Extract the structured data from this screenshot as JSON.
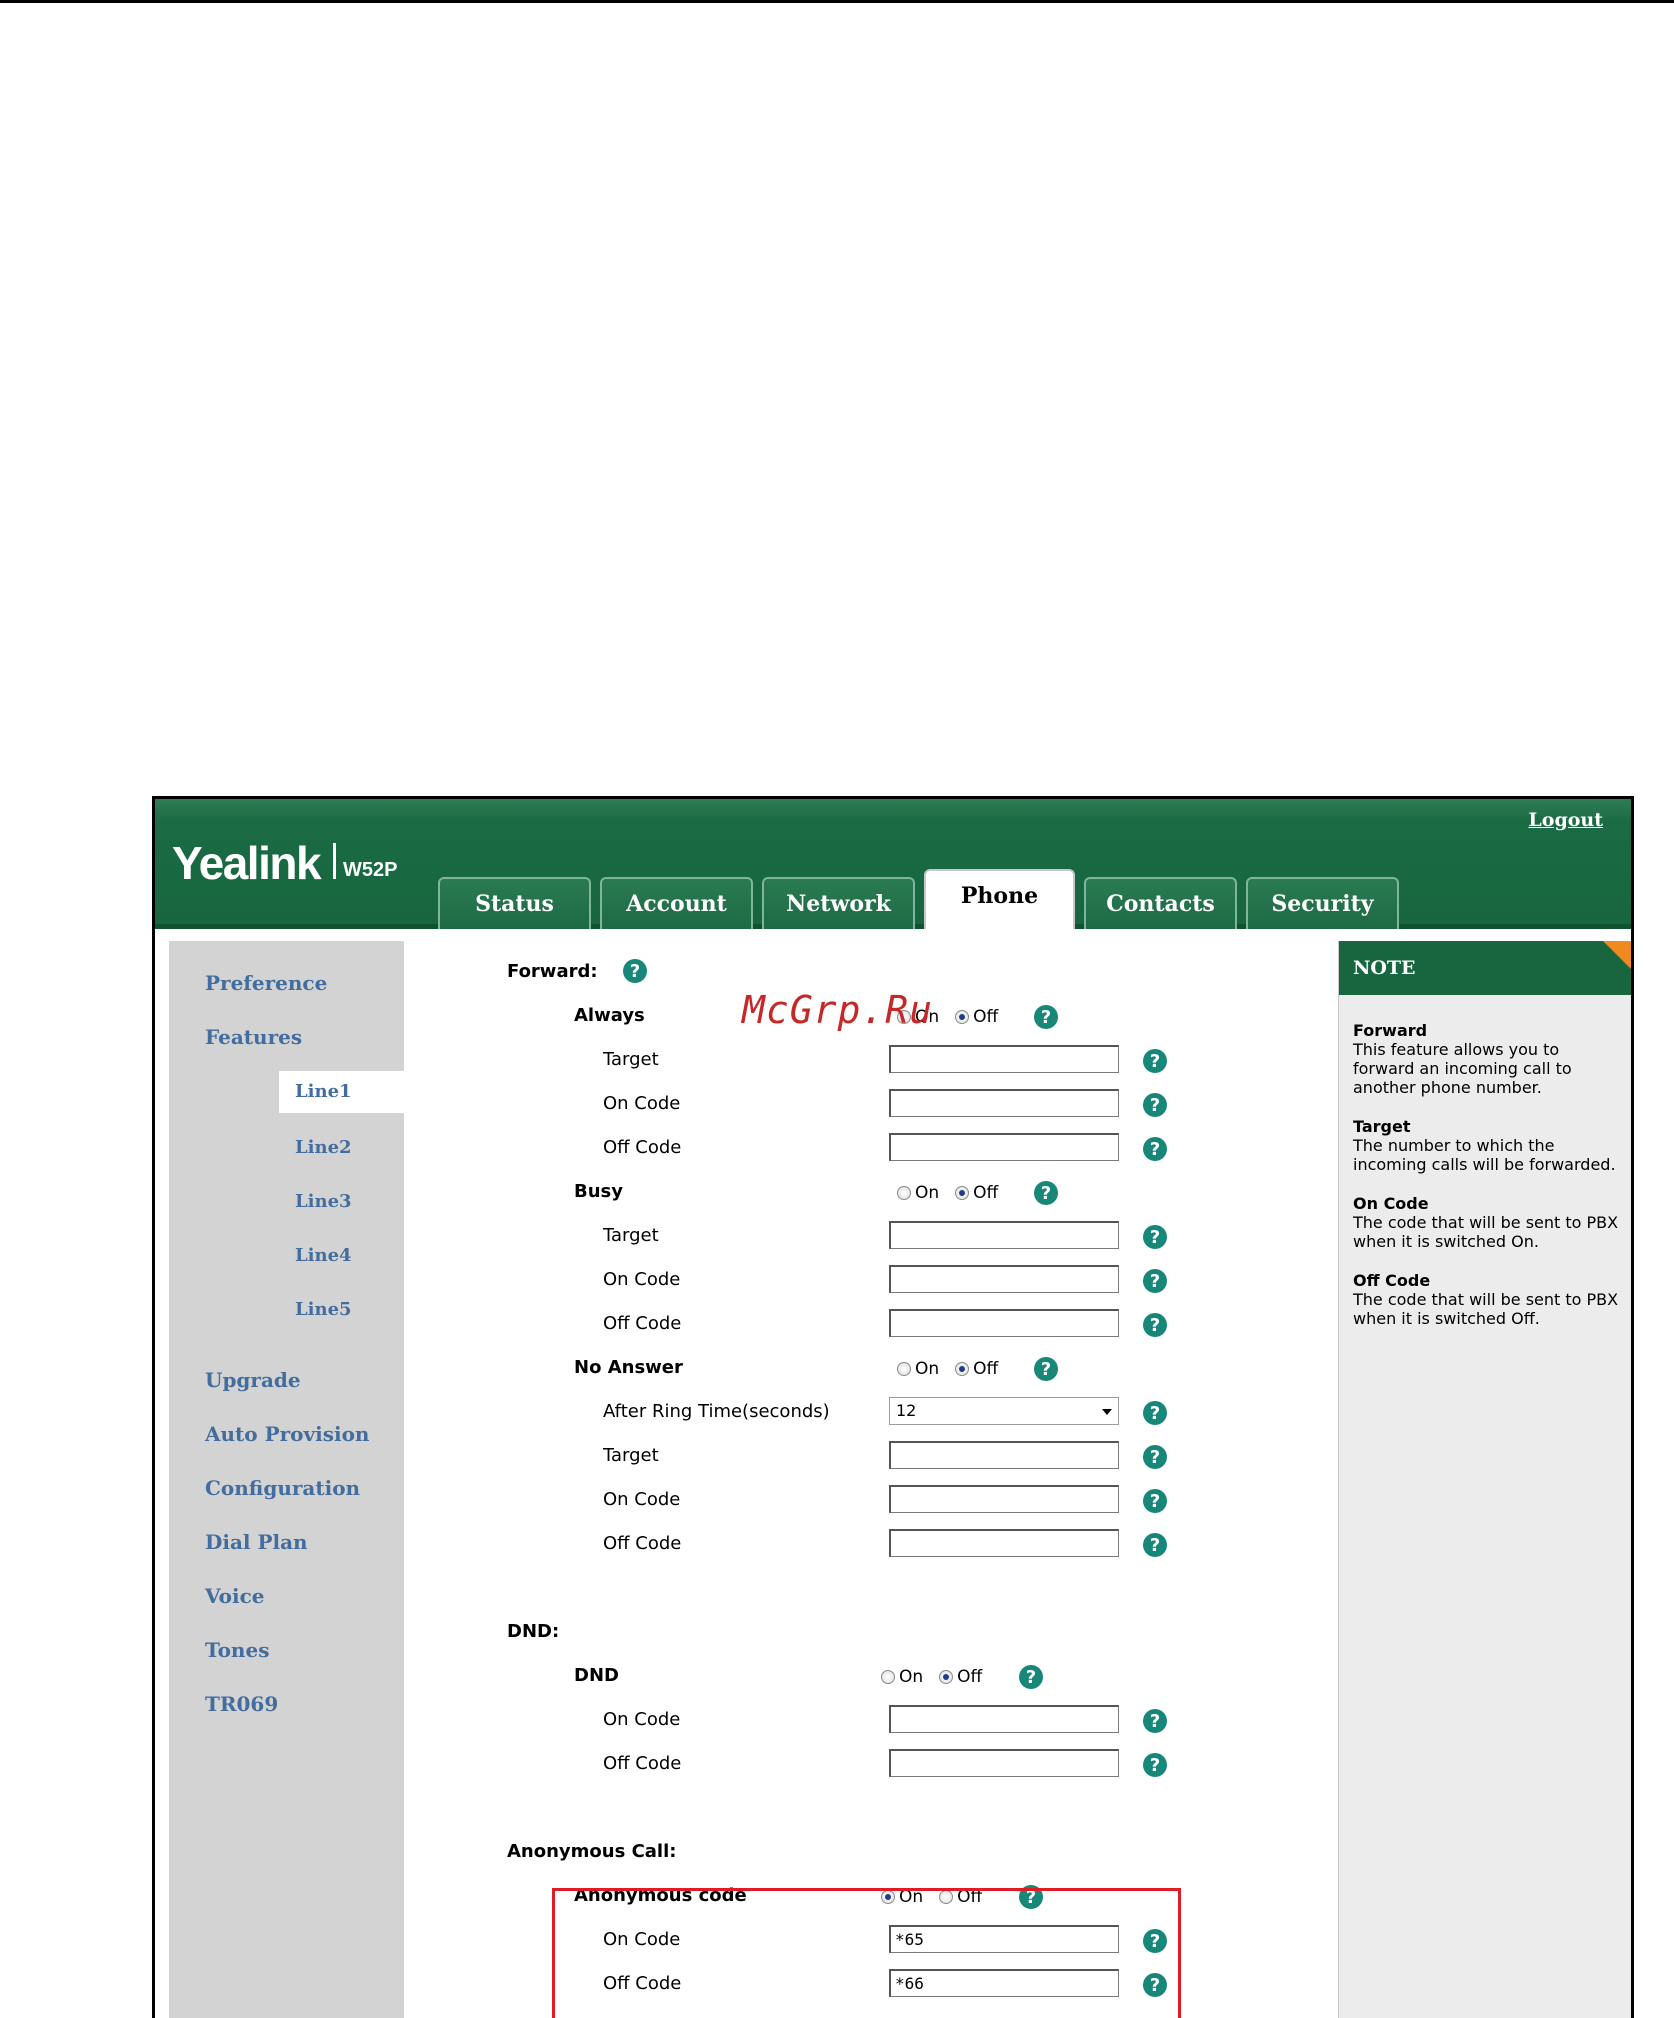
{
  "header": {
    "logo": "Yealink",
    "model": "W52P",
    "logout": "Logout"
  },
  "tabs": [
    "Status",
    "Account",
    "Network",
    "Phone",
    "Contacts",
    "Security"
  ],
  "sidebar": {
    "items": [
      "Preference",
      "Features",
      "Upgrade",
      "Auto Provision",
      "Configuration",
      "Dial Plan",
      "Voice",
      "Tones",
      "TR069"
    ],
    "lines": [
      "Line1",
      "Line2",
      "Line3",
      "Line4",
      "Line5"
    ]
  },
  "forward": {
    "title": "Forward:",
    "always": {
      "label": "Always",
      "on": "On",
      "off": "Off",
      "selected": "off"
    },
    "busy": {
      "label": "Busy",
      "on": "On",
      "off": "Off",
      "selected": "off"
    },
    "no_answer": {
      "label": "No Answer",
      "on": "On",
      "off": "Off",
      "selected": "off"
    },
    "target": "Target",
    "on_code": "On Code",
    "off_code": "Off Code",
    "after_ring_label": "After Ring Time(seconds)",
    "after_ring_value": "12"
  },
  "dnd": {
    "title": "DND:",
    "label": "DND",
    "on": "On",
    "off": "Off",
    "selected": "off",
    "on_code": "On Code",
    "off_code": "Off Code"
  },
  "anonymous": {
    "title": "Anonymous Call:",
    "label": "Anonymous code",
    "on": "On",
    "off": "Off",
    "selected": "on",
    "on_code": "On Code",
    "on_code_value": "*65",
    "off_code": "Off Code",
    "off_code_value": "*66"
  },
  "note": {
    "header": "NOTE",
    "entries": [
      {
        "title": "Forward",
        "text": "This feature allows you to forward an incoming call to another phone number."
      },
      {
        "title": "Target",
        "text": "The number to which the incoming calls will be forwarded."
      },
      {
        "title": "On Code",
        "text": "The code that will be sent to PBX when it is switched On."
      },
      {
        "title": "Off Code",
        "text": "The code that will be sent to PBX when it is switched Off."
      }
    ]
  },
  "watermark": "McGrp.Ru",
  "colors": {
    "brand_green": "#17663f",
    "link_blue": "#426d9e",
    "help_teal": "#17877a",
    "highlight_red": "#e01b24"
  }
}
